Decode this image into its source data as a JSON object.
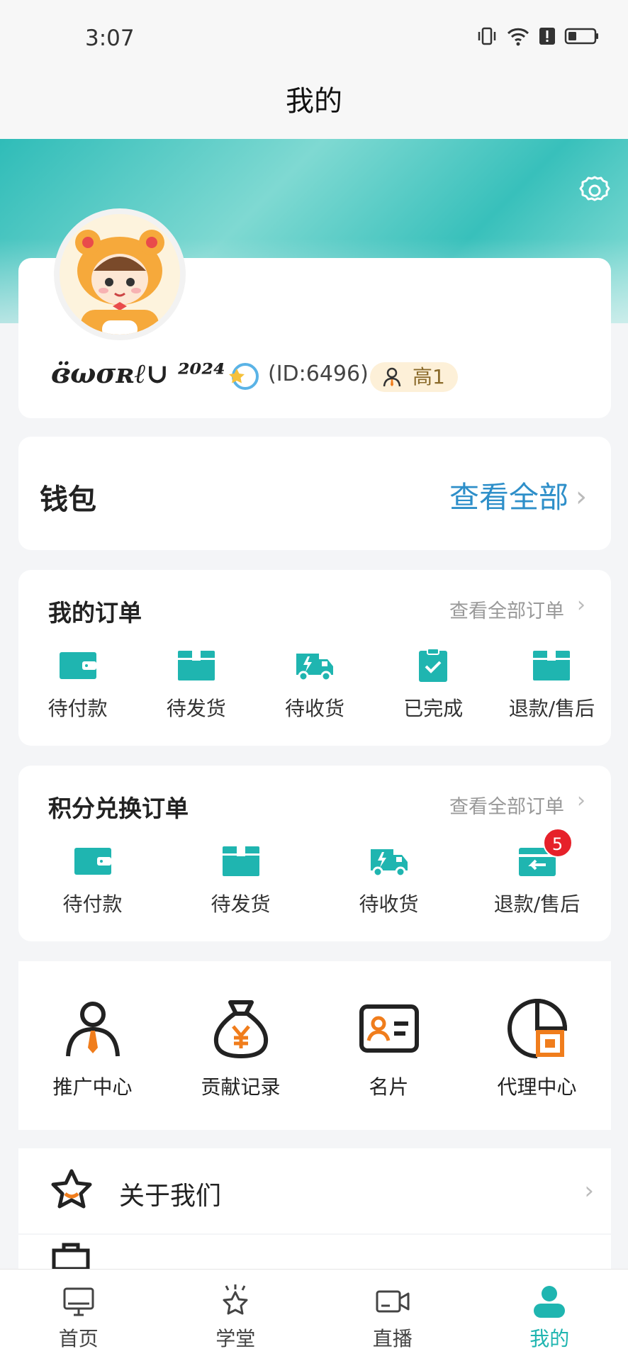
{
  "status_bar": {
    "time": "3:07"
  },
  "header": {
    "title": "我的"
  },
  "profile": {
    "username": "ɞ̈ωσʀℓ∪ ²⁰²⁴",
    "id_text": "(ID:6496)",
    "level": "高1"
  },
  "wallet": {
    "title": "钱包",
    "view_all": "查看全部"
  },
  "orders": {
    "title": "我的订单",
    "view_all": "查看全部订单",
    "items": [
      {
        "label": "待付款",
        "icon": "wallet-icon"
      },
      {
        "label": "待发货",
        "icon": "box-icon"
      },
      {
        "label": "待收货",
        "icon": "truck-icon"
      },
      {
        "label": "已完成",
        "icon": "clipboard-check-icon"
      },
      {
        "label": "退款/售后",
        "icon": "box-icon"
      }
    ]
  },
  "exchange_orders": {
    "title": "积分兑换订单",
    "view_all": "查看全部订单",
    "items": [
      {
        "label": "待付款",
        "icon": "wallet-icon"
      },
      {
        "label": "待发货",
        "icon": "box-icon"
      },
      {
        "label": "待收货",
        "icon": "truck-icon"
      },
      {
        "label": "退款/售后",
        "icon": "refund-icon",
        "badge": "5"
      }
    ]
  },
  "tools": [
    {
      "label": "推广中心",
      "icon": "promoter-icon"
    },
    {
      "label": "贡献记录",
      "icon": "money-bag-icon"
    },
    {
      "label": "名片",
      "icon": "business-card-icon"
    },
    {
      "label": "代理中心",
      "icon": "agent-icon"
    }
  ],
  "menu": {
    "about": "关于我们"
  },
  "tabbar": [
    {
      "label": "首页",
      "icon": "monitor-icon"
    },
    {
      "label": "学堂",
      "icon": "star-badge-icon"
    },
    {
      "label": "直播",
      "icon": "video-camera-icon"
    },
    {
      "label": "我的",
      "icon": "user-icon",
      "active": true
    }
  ],
  "colors": {
    "accent": "#1fb5b0",
    "link": "#2e8fc9",
    "orange": "#f07d1c",
    "badge": "#e6212a"
  }
}
